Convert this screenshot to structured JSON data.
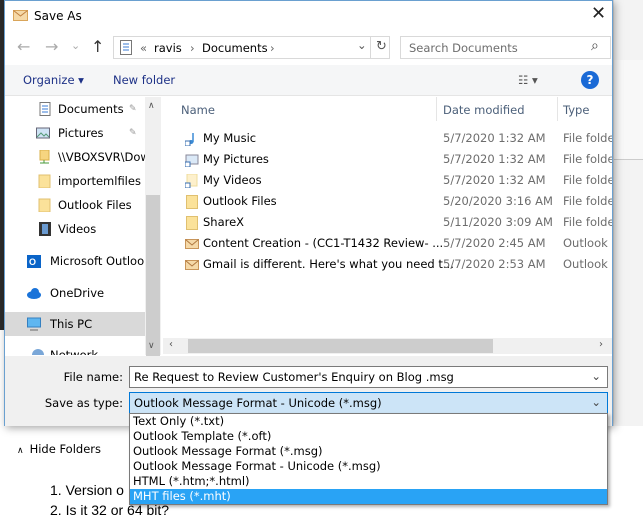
{
  "dialog": {
    "title": "Save As",
    "close": "✕"
  },
  "nav": {
    "back": "←",
    "forward": "→",
    "recent": "⌄",
    "up": "↑"
  },
  "address": {
    "overflow": "«",
    "crumbs": [
      "ravis",
      "Documents"
    ],
    "sep": "›",
    "dropdown": "⌄",
    "refresh": "↻"
  },
  "search": {
    "placeholder": "Search Documents",
    "icon": "⌕"
  },
  "toolbar": {
    "organize": "Organize ▾",
    "new_folder": "New folder",
    "view": "☷ ▾",
    "help": "?"
  },
  "sidebar": {
    "items": [
      {
        "label": "Documents",
        "icon": "documents-icon",
        "pinned": true
      },
      {
        "label": "Pictures",
        "icon": "pictures-icon",
        "pinned": true
      },
      {
        "label": "\\\\VBOXSVR\\Downloads",
        "icon": "network-drive-icon"
      },
      {
        "label": "importemlfiles",
        "icon": "folder-icon"
      },
      {
        "label": "Outlook Files",
        "icon": "folder-icon"
      },
      {
        "label": "Videos",
        "icon": "videos-icon"
      },
      {
        "label": "Microsoft Outlook",
        "icon": "outlook-icon"
      },
      {
        "label": "OneDrive",
        "icon": "onedrive-icon"
      },
      {
        "label": "This PC",
        "icon": "pc-icon",
        "selected": true
      },
      {
        "label": "Network",
        "icon": "network-icon"
      }
    ],
    "pin": "📌"
  },
  "list": {
    "columns": [
      "Name",
      "Date modified",
      "Type"
    ],
    "rows": [
      {
        "name": "My Music",
        "date": "5/7/2020 1:32 AM",
        "type": "File folder",
        "icon": "music-folder-icon"
      },
      {
        "name": "My Pictures",
        "date": "5/7/2020 1:32 AM",
        "type": "File folder",
        "icon": "pictures-folder-icon"
      },
      {
        "name": "My Videos",
        "date": "5/7/2020 1:32 AM",
        "type": "File folder",
        "icon": "videos-folder-icon"
      },
      {
        "name": "Outlook Files",
        "date": "5/20/2020 3:16 AM",
        "type": "File folder",
        "icon": "folder-icon"
      },
      {
        "name": "ShareX",
        "date": "5/11/2020 3:09 AM",
        "type": "File folder",
        "icon": "folder-icon"
      },
      {
        "name": "Content Creation  - (CC1-T1432 Review- ...",
        "date": "5/7/2020 2:45 AM",
        "type": "Outlook Item",
        "icon": "mail-icon"
      },
      {
        "name": "Gmail is different. Here's what you need t...",
        "date": "5/7/2020 2:53 AM",
        "type": "Outlook Item",
        "icon": "mail-icon"
      }
    ]
  },
  "form": {
    "file_name_label": "File name:",
    "file_name": "Re Request to Review Customer's Enquiry on Blog .msg",
    "type_label": "Save as type:",
    "type_value": "Outlook Message Format - Unicode (*.msg)",
    "hide_folders": "Hide Folders",
    "type_options": [
      "Text Only (*.txt)",
      "Outlook Template (*.oft)",
      "Outlook Message Format (*.msg)",
      "Outlook Message Format - Unicode (*.msg)",
      "HTML (*.htm;*.html)",
      "MHT files (*.mht)"
    ],
    "highlighted_option": 5
  },
  "background": {
    "line1": "1.  Version o",
    "line2": "2.  Is it 32 or 64 bit?"
  },
  "colors": {
    "accent": "#0078d7",
    "highlight": "#29a3f5",
    "selection": "#cce4f7"
  }
}
